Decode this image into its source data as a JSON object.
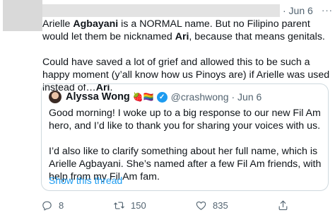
{
  "tweet": {
    "date": "· Jun 6",
    "more": "···",
    "para1": [
      {
        "t": "Arielle ",
        "b": false
      },
      {
        "t": "Agbayani",
        "b": true
      },
      {
        "t": " is a NORMAL name. But no Filipino parent would let them be nicknamed ",
        "b": false
      },
      {
        "t": "Ari",
        "b": true
      },
      {
        "t": ", because that means genitals.",
        "b": false
      }
    ],
    "para2": [
      {
        "t": "Could have saved a lot of grief and allowed this to be such a happy moment (y’all know how us Pinoys are) if Arielle was used instead of…",
        "b": false
      },
      {
        "t": "Ari",
        "b": true
      },
      {
        "t": ".",
        "b": false
      }
    ]
  },
  "quote": {
    "name": "Alyssa Wong",
    "emojis": "🍓🏳️‍🌈",
    "handle_date": "@crashwong · Jun 6",
    "text1": "Good morning! I woke up to a big response to our new Fil Am hero, and I’d like to thank you for sharing your voices with us.",
    "text2": "I’d also like to clarify something about her full name, which is Arielle Agbayani. She’s named after a few Fil Am friends, with help from my Fil Am fam.",
    "show_thread": "Show this thread"
  },
  "actions": {
    "reply_count": "8",
    "retweet_count": "150",
    "like_count": "835"
  },
  "colors": {
    "link": "#1d9bf0",
    "muted": "#536471",
    "border": "#cfd9de"
  }
}
